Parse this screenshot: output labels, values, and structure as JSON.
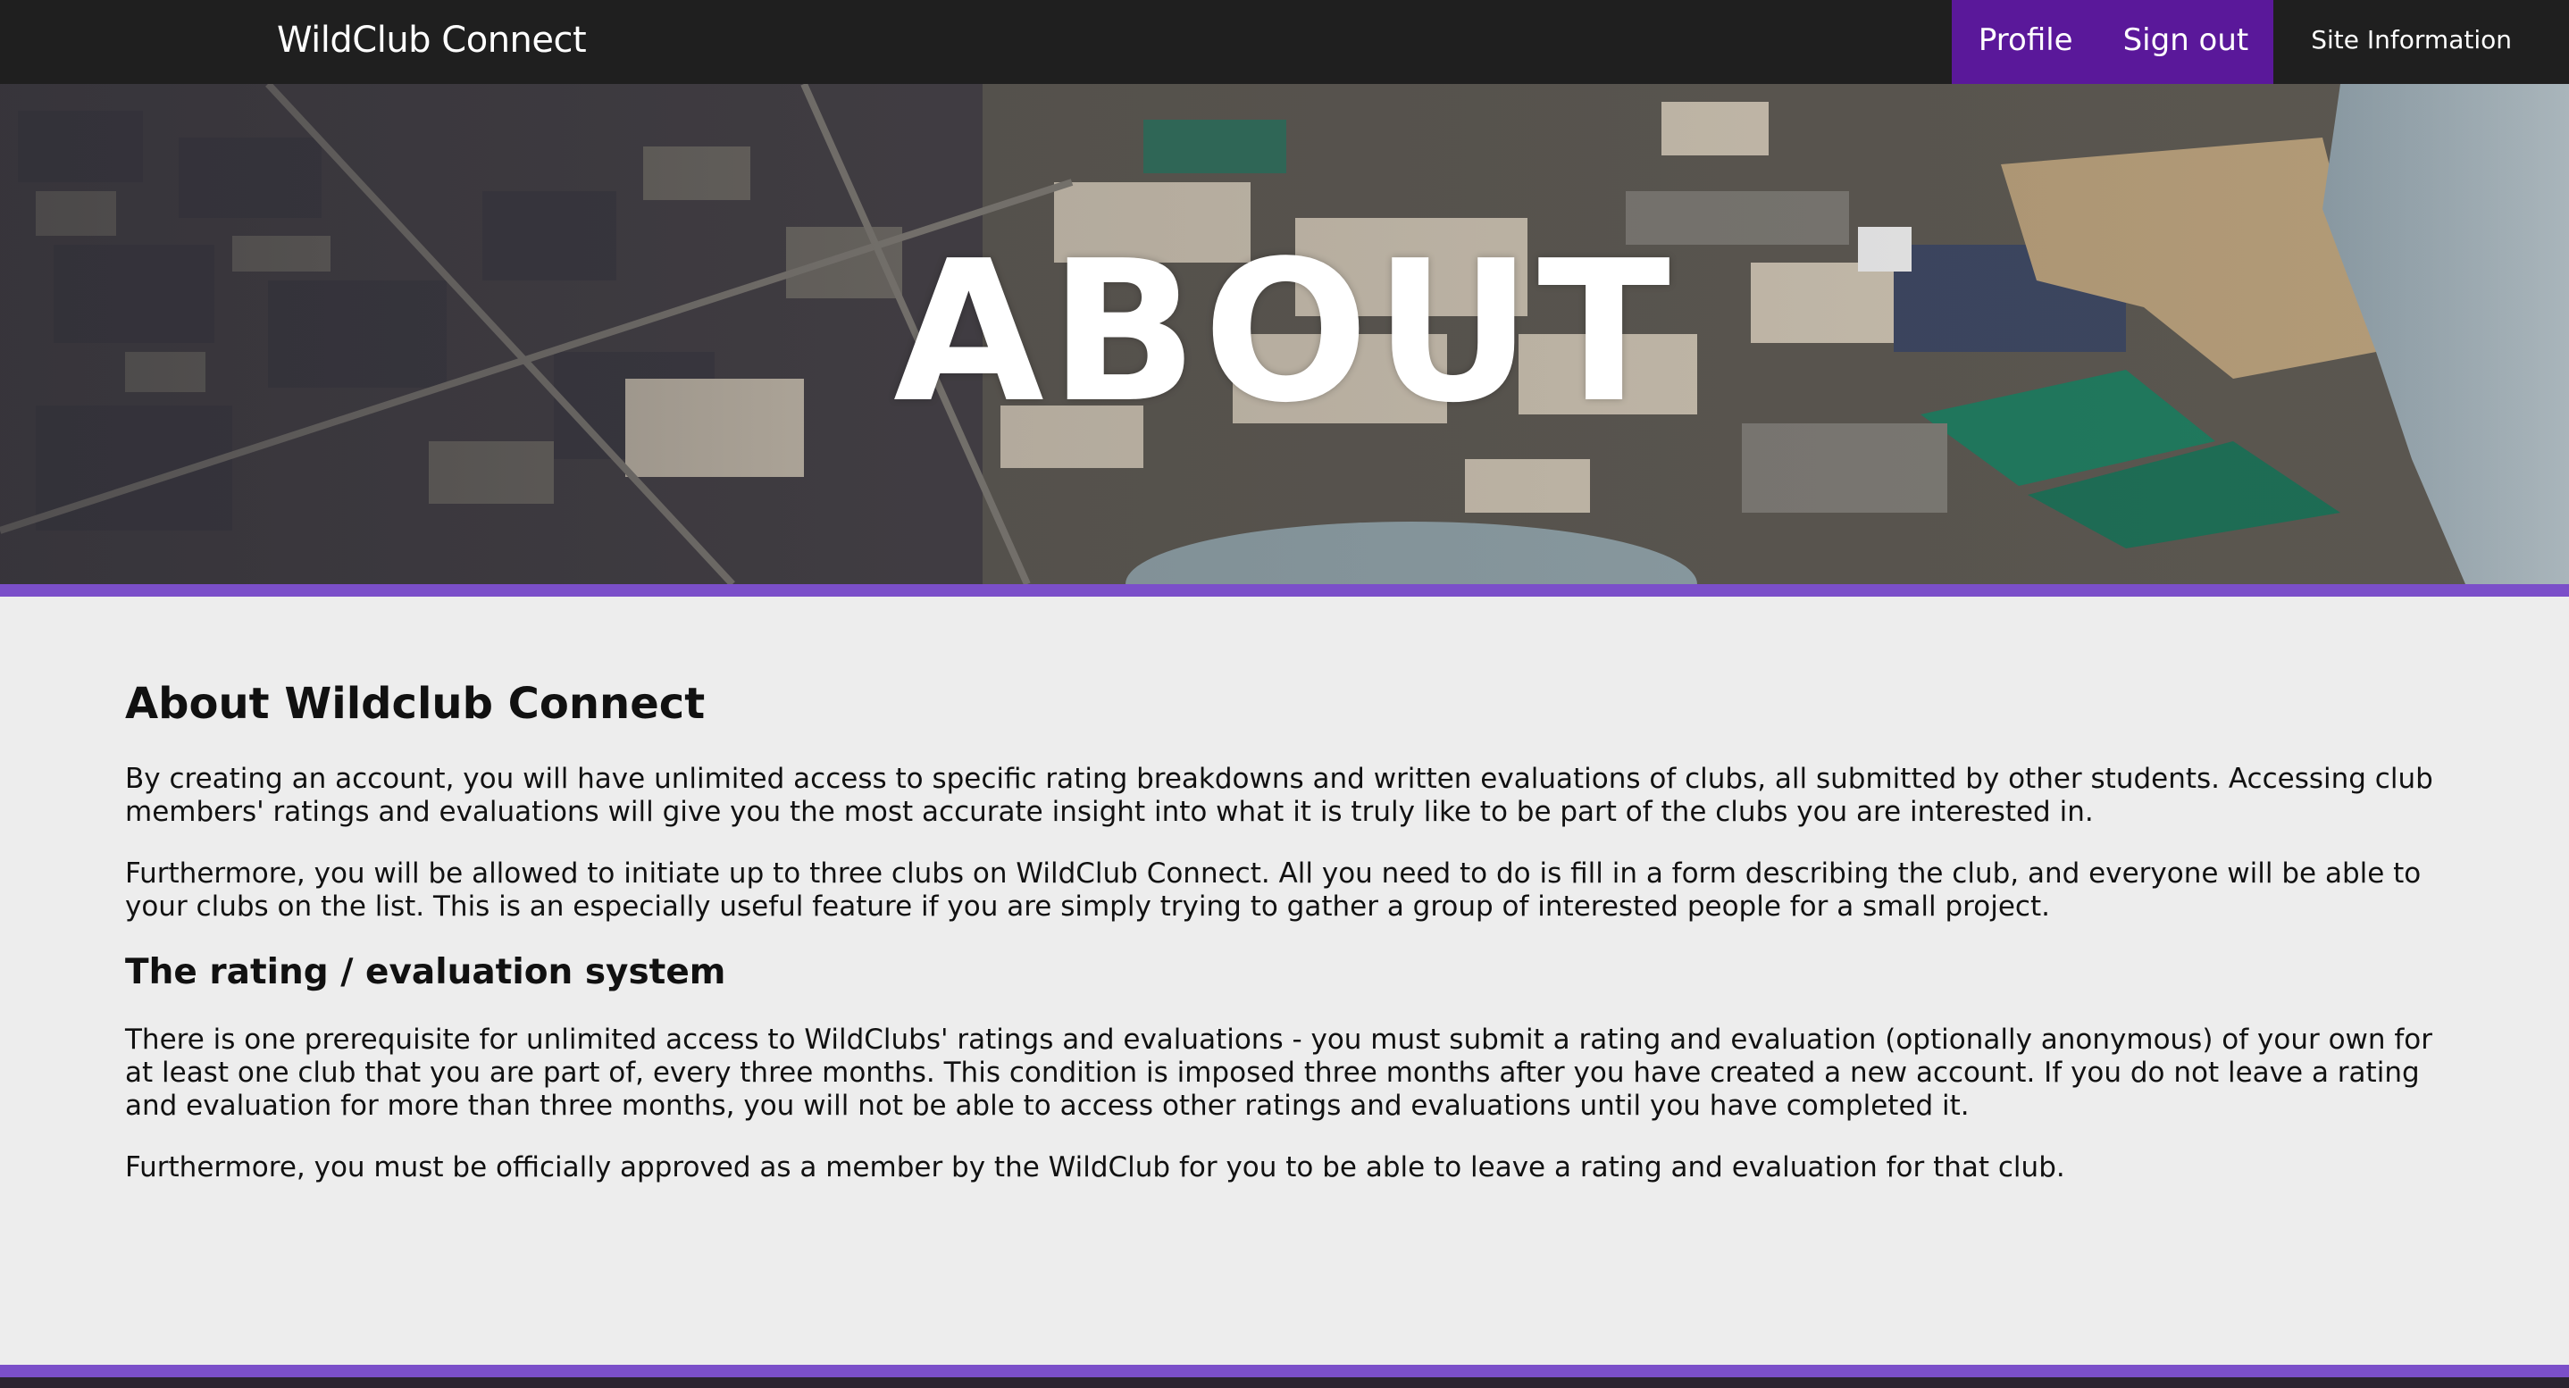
{
  "nav": {
    "brand": "WildClub Connect",
    "links": {
      "profile": "Profile",
      "sign_out": "Sign out",
      "site_information": "Site Information"
    }
  },
  "hero": {
    "title": "ABOUT"
  },
  "main": {
    "heading": "About Wildclub Connect",
    "intro_paragraphs": [
      "By creating an account, you will have unlimited access to specific rating breakdowns and written evaluations of clubs, all submitted by other students. Accessing club members' ratings and evaluations will give you the most accurate insight into what it is truly like to be part of the clubs you are interested in.",
      "Furthermore, you will be allowed to initiate up to three clubs on WildClub Connect. All you need to do is fill in a form describing the club, and everyone will be able to your clubs on the list. This is an especially useful feature if you are simply trying to gather a group of interested people for a small project."
    ],
    "subheading": "The rating / evaluation system",
    "rating_paragraphs": [
      "There is one prerequisite for unlimited access to WildClubs' ratings and evaluations - you must submit a rating and evaluation (optionally anonymous) of your own for at least one club that you are part of, every three months. This condition is imposed three months after you have created a new account. If you do not leave a rating and evaluation for more than three months, you will not be able to access other ratings and evaluations until you have completed it.",
      "Furthermore, you must be officially approved as a member by the WildClub for you to be able to leave a rating and evaluation for that club."
    ]
  },
  "colors": {
    "navbar": "#1f1f1f",
    "nav_highlight": "#5a189a",
    "accent_stripe": "#7b4fc9",
    "page_background": "#ededed"
  }
}
